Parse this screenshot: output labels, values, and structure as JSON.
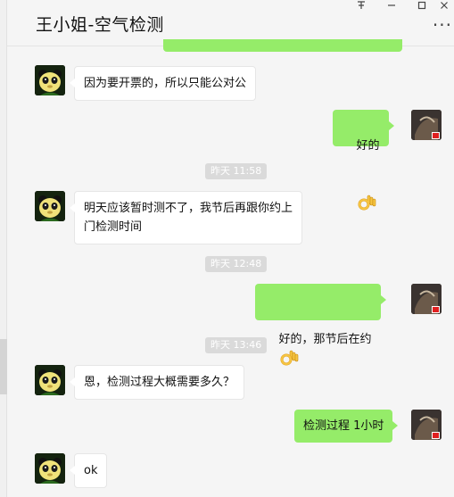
{
  "chat": {
    "title": "王小姐-空气检测",
    "window_controls": [
      "pin-icon",
      "minimize-icon",
      "maximize-icon",
      "close-icon"
    ],
    "more_label": "···"
  },
  "messages": [
    {
      "from": "them",
      "text": "因为要开票的，所以只能公对公"
    },
    {
      "from": "me",
      "text": "好的",
      "emoji_after": "ok-hand-icon"
    },
    {
      "time": "昨天 11:58"
    },
    {
      "from": "them",
      "text": "明天应该暂时测不了，我节后再跟你约上\n门检测时间"
    },
    {
      "time": "昨天 12:48"
    },
    {
      "from": "me",
      "text": "好的，那节后在约",
      "emoji_before": "ok-hand-icon"
    },
    {
      "time": "昨天 13:46"
    },
    {
      "from": "them",
      "text": "恩，检测过程大概需要多久？"
    },
    {
      "from": "me",
      "text": "检测过程 1小时"
    },
    {
      "from": "them",
      "text": "ok"
    }
  ],
  "colors": {
    "outgoing_bubble": "#95ec69",
    "incoming_bubble": "#ffffff",
    "background": "#f5f5f5",
    "time_badge": "#dadada"
  }
}
